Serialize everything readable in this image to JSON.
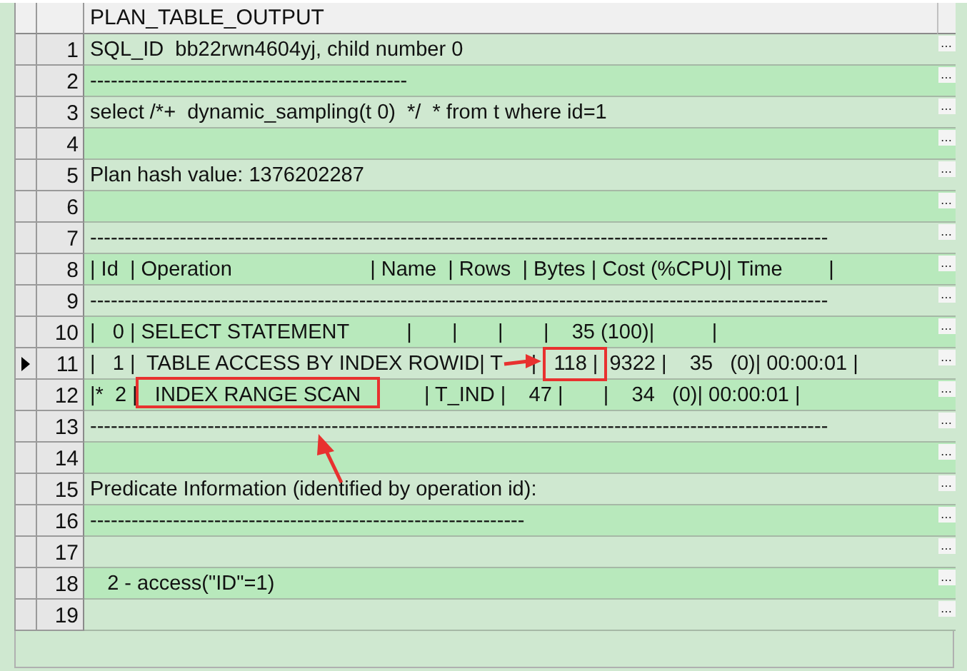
{
  "grid": {
    "column_header": "PLAN_TABLE_OUTPUT",
    "rows": [
      {
        "number": "1",
        "text": "SQL_ID  bb22rwn4604yj, child number 0",
        "current": false,
        "button": "…"
      },
      {
        "number": "2",
        "text": "----------------------------------------------",
        "current": false,
        "button": "…"
      },
      {
        "number": "3",
        "text": "select /*+  dynamic_sampling(t 0)  */  * from t where id=1",
        "current": false,
        "button": "…"
      },
      {
        "number": "4",
        "text": "",
        "current": false,
        "button": "…"
      },
      {
        "number": "5",
        "text": "Plan hash value: 1376202287",
        "current": false,
        "button": "…"
      },
      {
        "number": "6",
        "text": "",
        "current": false,
        "button": "…"
      },
      {
        "number": "7",
        "text": "-----------------------------------------------------------------------------------------------------------",
        "current": false,
        "button": "…"
      },
      {
        "number": "8",
        "text": "| Id  | Operation                        | Name  | Rows  | Bytes | Cost (%CPU)| Time        |",
        "current": false,
        "button": "…"
      },
      {
        "number": "9",
        "text": "-----------------------------------------------------------------------------------------------------------",
        "current": false,
        "button": "…"
      },
      {
        "number": "10",
        "text": "|   0 | SELECT STATEMENT          |       |       |       |    35 (100)|          |",
        "current": false,
        "button": "…"
      },
      {
        "number": "11",
        "text": "|   1 |  TABLE ACCESS BY INDEX ROWID| T     |   118 |  9322 |    35   (0)| 00:00:01 |",
        "current": true,
        "button": "…"
      },
      {
        "number": "12",
        "text": "|*  2 |   INDEX RANGE SCAN           | T_IND |    47 |       |    34   (0)| 00:00:01 |",
        "current": false,
        "button": "…"
      },
      {
        "number": "13",
        "text": "-----------------------------------------------------------------------------------------------------------",
        "current": false,
        "button": "…"
      },
      {
        "number": "14",
        "text": "",
        "current": false,
        "button": "…"
      },
      {
        "number": "15",
        "text": "Predicate Information (identified by operation id):",
        "current": false,
        "button": "…"
      },
      {
        "number": "16",
        "text": "---------------------------------------------------------------",
        "current": false,
        "button": "…"
      },
      {
        "number": "17",
        "text": "",
        "current": false,
        "button": "…"
      },
      {
        "number": "18",
        "text": "   2 - access(\"ID\"=1)",
        "current": false,
        "button": "…"
      },
      {
        "number": "19",
        "text": "",
        "current": false,
        "button": "…"
      }
    ]
  }
}
